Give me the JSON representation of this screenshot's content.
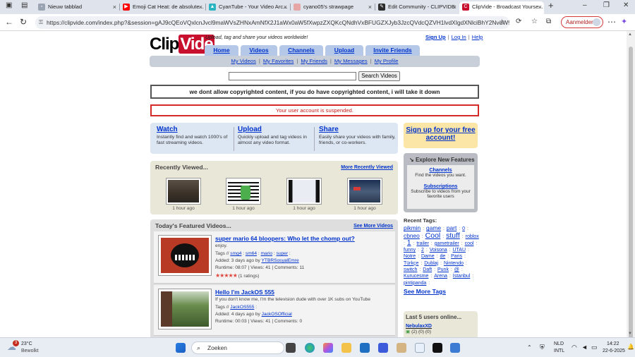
{
  "browser": {
    "tabs": [
      {
        "title": "Nieuw tabblad",
        "icon": "new-tab-icon",
        "color": "#6b7280"
      },
      {
        "title": "Emoji Cat Heat: de absolute...",
        "icon": "youtube-icon",
        "color": "#ff0000"
      },
      {
        "title": "CyanTube - Your Video Arc...",
        "icon": "cyantube-icon",
        "color": "#2bb5c2"
      },
      {
        "title": "cyano05's strawpage",
        "icon": "strawpage-icon",
        "color": "#e6a6a6"
      },
      {
        "title": "Edit Community - CLIPVIDE",
        "icon": "clipvide-icon",
        "color": "#2b2b2b"
      },
      {
        "title": "ClipVide - Broadcast Yourse...",
        "icon": "clipvide-icon",
        "color": "#c8102e"
      }
    ],
    "url": "https://clipvide.com/index.php?&session=gAJ9cQEoVQxlcnJvcl9maWVsZHNxAmNfX2J1aWx0aW5fXwpzZXQKcQNdhVxBFUGZXJyb3JzcQVdcQZVH1lvdXIgdXNlciBhY2NvdW5...",
    "signin_label": "Aanmelden"
  },
  "site": {
    "logo_part1": "Clip",
    "logo_part2": "Vide",
    "tagline": "Upload, tag and share your videos worldwide!",
    "top_links": [
      "Sign Up",
      "Log In",
      "Help"
    ],
    "nav_tabs": [
      "Home",
      "Videos",
      "Channels",
      "Upload",
      "Invite Friends"
    ],
    "sub_nav": [
      "My Videos",
      "My Favorites",
      "My Friends",
      "My Messages",
      "My Profile"
    ],
    "search_placeholder": "",
    "search_button": "Search Videos",
    "notice": "we dont allow copyrighted content, if you do have copyrighted content, i will take it down",
    "suspended": "Your user account is suspended.",
    "promo": [
      {
        "title": "Watch",
        "desc": "Instantly find and watch 1000's of fast streaming videos."
      },
      {
        "title": "Upload",
        "desc": "Quickly upload and tag videos in almost any video format."
      },
      {
        "title": "Share",
        "desc": "Easily share your videos with family, friends, or co-workers."
      }
    ],
    "signup_box": "Sign up for your free account!",
    "explore": {
      "title": "Explore New Features",
      "items": [
        {
          "link": "Channels",
          "desc": "Find the videos you want."
        },
        {
          "link": "Subscriptions",
          "desc": "Subscribe to videos from your favorite users"
        }
      ]
    },
    "recently_viewed": {
      "title": "Recently Viewed...",
      "more": "More Recently Viewed",
      "items": [
        {
          "time": "1 hour ago"
        },
        {
          "time": "1 hour ago"
        },
        {
          "time": "1 hour ago"
        },
        {
          "time": "1 hour ago"
        }
      ]
    },
    "featured": {
      "title": "Today's Featured Videos...",
      "more": "See More Videos",
      "videos": [
        {
          "title": "super mario 64 bloopers: Who let the chomp out?",
          "desc": "enjoy.",
          "tags_label": "Tags //",
          "tags": [
            "smg4",
            "sm64",
            "mario",
            "super"
          ],
          "added_label": "Added: 3 days ago by",
          "author": "YTBRSosyalEmre",
          "stats": "Runtime: 08:07 | Views: 41 | Comments: 11",
          "rating": 5,
          "ratings_text": "(1 ratings)"
        },
        {
          "title": "Hello I'm JackOS 555",
          "desc": "If you don't know me, I'm the television dude with over 1K subs on YouTube",
          "tags_label": "Tags //",
          "tags": [
            "JackOS555"
          ],
          "added_label": "Added: 4 days ago by",
          "author": "JackOSOfficial",
          "stats": "Runtime: 00:03 | Views: 41 | Comments: 0"
        }
      ]
    },
    "recent_tags_title": "Recent Tags:",
    "recent_tags": [
      "pikmin",
      "game",
      "part",
      "0",
      "cbneo",
      "Cool",
      "stuff",
      "roblox",
      "1",
      "trailer",
      "gametrailer",
      "cool",
      "funny",
      "2",
      "Voisona",
      "UTAU",
      "Notre",
      "Dame",
      "de",
      "Paris",
      "Türkçe",
      "Dublaj",
      "Nintendo",
      "switch",
      "Daft",
      "Punk",
      "@",
      "Kurucesme",
      "Arena",
      "İstanbul",
      "pintipanda"
    ],
    "see_more_tags": "See More Tags",
    "last_users": {
      "title": "Last 5 users online...",
      "user": "NebulaxXD",
      "meta": "(2) (0) (0)"
    }
  },
  "taskbar": {
    "weather_temp": "23°C",
    "weather_desc": "Bewolkt",
    "weather_badge": "3",
    "search_label": "Zoeken",
    "lang": "NLD",
    "lang2": "INTL",
    "time": "14:22",
    "date": "22-6-2025"
  }
}
